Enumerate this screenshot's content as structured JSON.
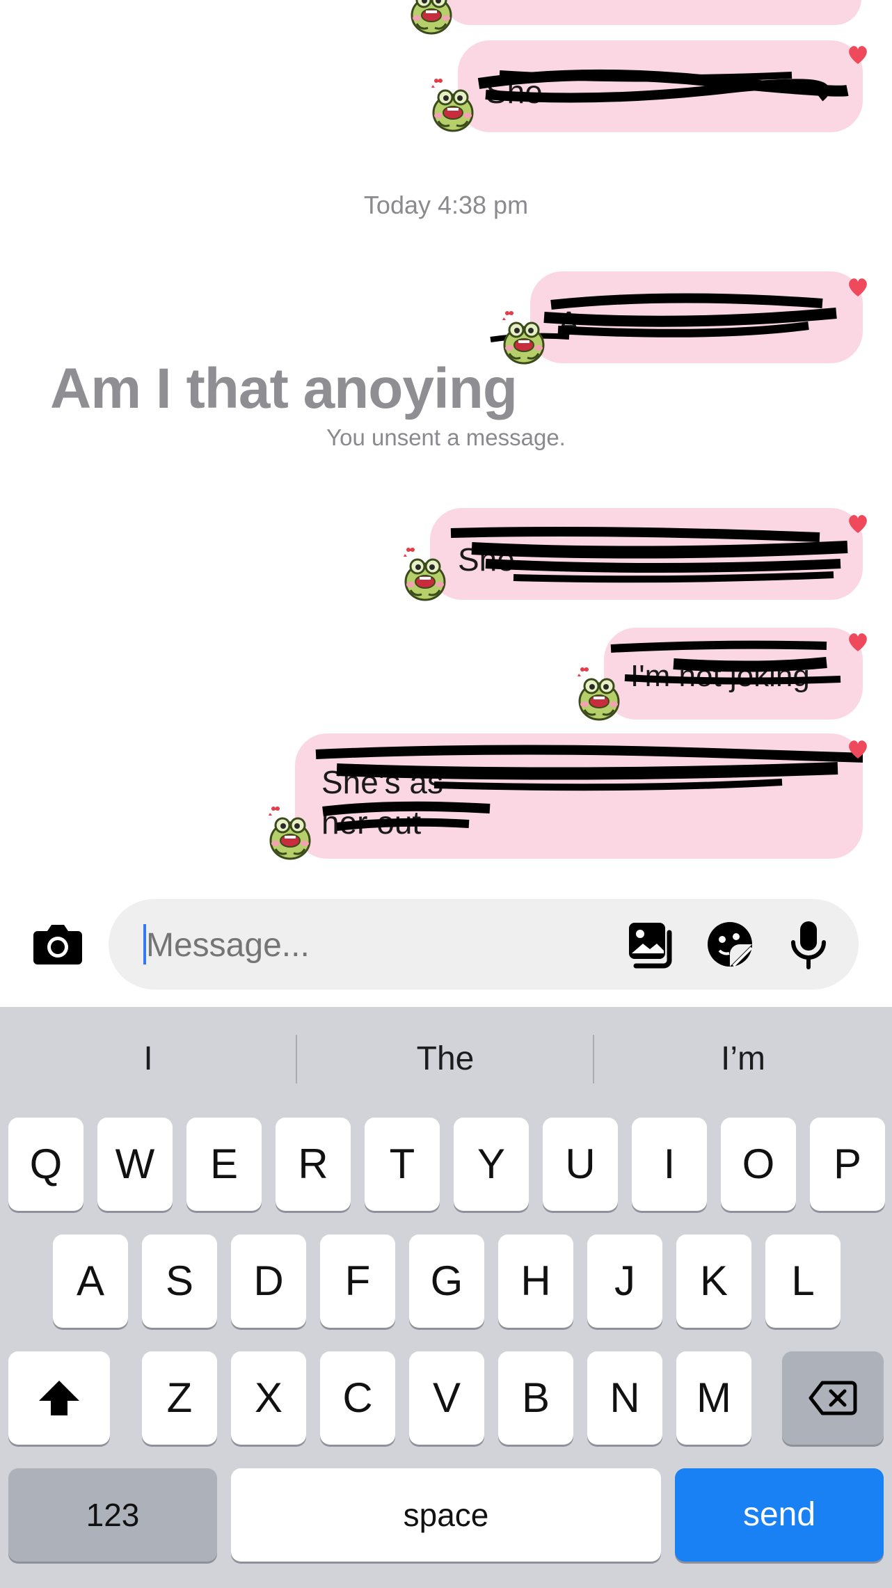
{
  "messages": {
    "m0": {
      "text": ""
    },
    "m1": {
      "text": "She"
    },
    "m2": {
      "text": "A"
    },
    "m3": {
      "text": "She"
    },
    "m4": {
      "text": "I'm not joking"
    },
    "m5": {
      "line1": "She's as",
      "line2": "her out"
    }
  },
  "timestamp": "Today 4:38 pm",
  "overlay_text": "Am I that anoying",
  "unsent_notice": "You unsent a message.",
  "composer": {
    "placeholder": "Message..."
  },
  "icons": {
    "camera": "camera-icon",
    "gallery": "gallery-icon",
    "sticker": "sticker-icon",
    "mic": "microphone-icon",
    "shift": "shift-icon",
    "backspace": "backspace-icon"
  },
  "suggestions": [
    "I",
    "The",
    "I’m"
  ],
  "keyboard": {
    "row1": [
      "Q",
      "W",
      "E",
      "R",
      "T",
      "Y",
      "U",
      "I",
      "O",
      "P"
    ],
    "row2": [
      "A",
      "S",
      "D",
      "F",
      "G",
      "H",
      "J",
      "K",
      "L"
    ],
    "row3": [
      "Z",
      "X",
      "C",
      "V",
      "B",
      "N",
      "M"
    ],
    "numbers_label": "123",
    "space_label": "space",
    "send_label": "send"
  },
  "colors": {
    "bubble": "#fbd7e4",
    "heart": "#ef4a5b",
    "send": "#1a81f5",
    "keyboard_bg": "#d1d3d9"
  }
}
